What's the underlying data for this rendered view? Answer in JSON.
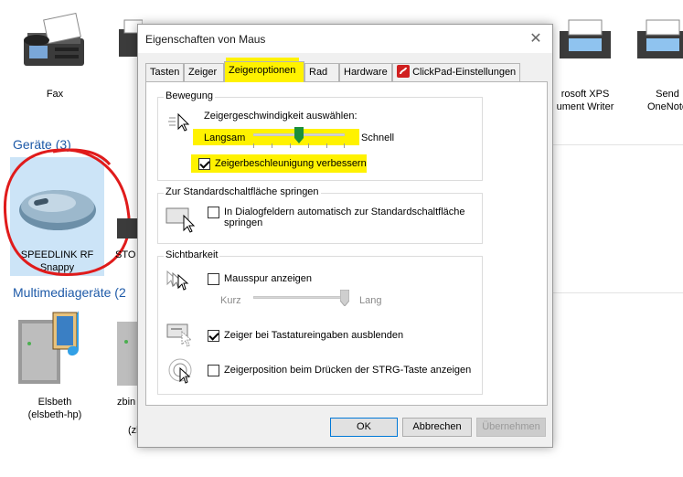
{
  "background": {
    "devices_row1": [
      {
        "label": "Fax"
      },
      {
        "label_line1": "rosoft XPS",
        "label_line2": "ument Writer"
      },
      {
        "label_line1": "Send",
        "label_line2": "OneNote"
      }
    ],
    "group_devices": "Geräte (3)",
    "device_mouse": {
      "line1": "SPEEDLINK RF",
      "line2": "Snappy"
    },
    "device_sto": "STO",
    "group_multimedia": "Multimediageräte (2",
    "media1": {
      "line1": "Elsbeth",
      "line2": "(elsbeth-hp)"
    },
    "media2": {
      "line1": "zbin",
      "line2": "(zb"
    },
    "colors": {
      "group_title": "#1e5aa8",
      "highlight": "#fff200",
      "annotation_circle": "#e01b1b"
    }
  },
  "dialog": {
    "title": "Eigenschaften von Maus",
    "close_icon": "close-icon",
    "tabs": [
      "Tasten",
      "Zeiger",
      "Zeigeroptionen",
      "Rad",
      "Hardware",
      "ClickPad-Einstellungen"
    ],
    "active_tab": "Zeigeroptionen",
    "movement": {
      "title": "Bewegung",
      "speed_label": "Zeigergeschwindigkeit auswählen:",
      "slow": "Langsam",
      "fast": "Schnell",
      "speed_level": 0.5,
      "accel_label": "Zeigerbeschleunigung verbessern",
      "accel_checked": true
    },
    "snap": {
      "title": "Zur Standardschaltfläche springen",
      "label": "In Dialogfeldern automatisch zur Standardschaltfläche springen",
      "checked": false
    },
    "visibility": {
      "title": "Sichtbarkeit",
      "trails_label": "Mausspur anzeigen",
      "trails_checked": false,
      "short": "Kurz",
      "long": "Lang",
      "trail_level": 1.0,
      "hide_label": "Zeiger bei Tastatureingaben ausblenden",
      "hide_checked": true,
      "ctrl_label": "Zeigerposition beim Drücken der STRG-Taste anzeigen",
      "ctrl_checked": false
    },
    "buttons": {
      "ok": "OK",
      "cancel": "Abbrechen",
      "apply": "Übernehmen"
    }
  }
}
